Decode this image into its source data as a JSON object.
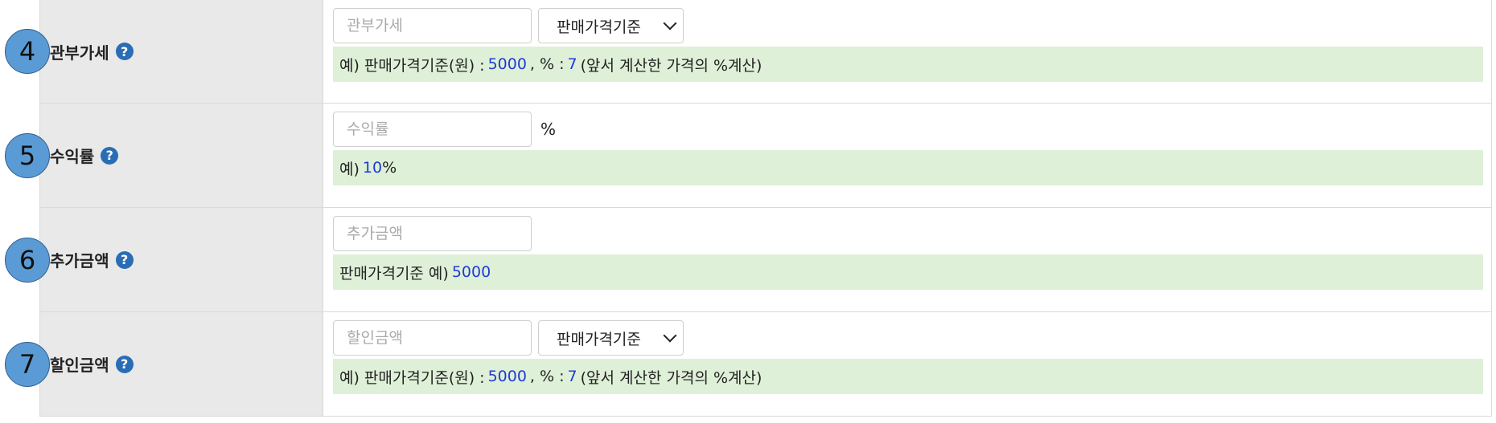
{
  "rows": [
    {
      "marker": "4",
      "label": "관부가세",
      "input_placeholder": "관부가세",
      "select_value": "판매가격기준",
      "hint": {
        "prefix": "예) 판매가격기준(원) :",
        "value1": "5000",
        "mid": ", % :",
        "value2": "7",
        "suffix": "(앞서 계산한 가격의 %계산)"
      }
    },
    {
      "marker": "5",
      "label": "수익률",
      "input_placeholder": "수익률",
      "unit": "%",
      "hint": {
        "prefix": "예)",
        "value1": "10",
        "suffix": "%"
      }
    },
    {
      "marker": "6",
      "label": "추가금액",
      "input_placeholder": "추가금액",
      "hint": {
        "prefix": "판매가격기준 예)",
        "value1": "5000"
      }
    },
    {
      "marker": "7",
      "label": "할인금액",
      "input_placeholder": "할인금액",
      "select_value": "판매가격기준",
      "hint": {
        "prefix": "예) 판매가격기준(원) :",
        "value1": "5000",
        "mid": ", % :",
        "value2": "7",
        "suffix": "(앞서 계산한 가격의 %계산)"
      }
    }
  ],
  "help_icon_glyph": "?"
}
